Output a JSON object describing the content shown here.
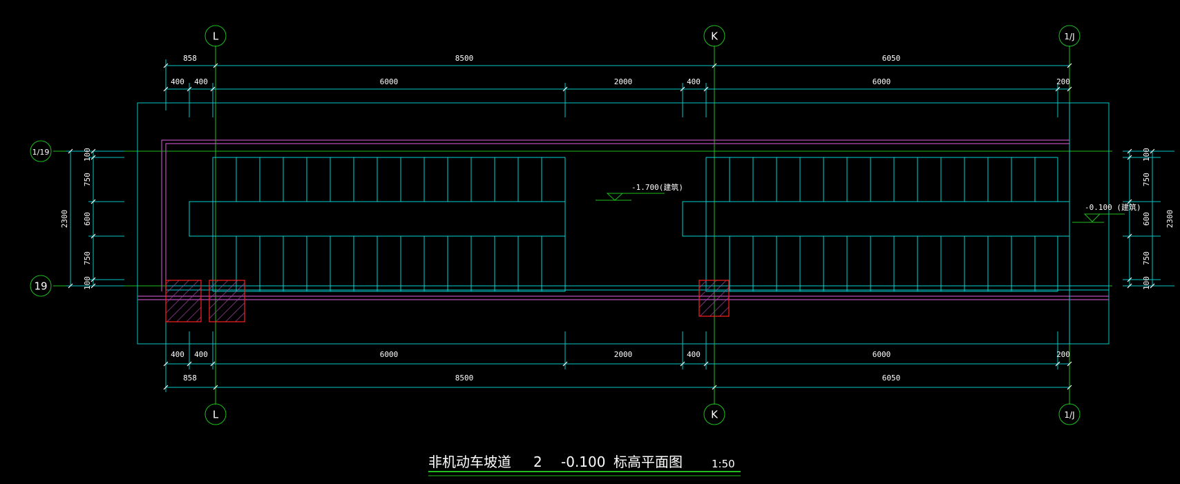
{
  "colors": {
    "background": "#000000",
    "dimension": "#00c8c8",
    "axis_line": "#1fc01f",
    "outline": "#00c8c8",
    "stair": "#00d5d5",
    "wall": "#b84cb8",
    "column": "#ff2020",
    "text": "#ffffff"
  },
  "axes": {
    "L": "L",
    "K": "K",
    "1J": "1/J",
    "19": "19",
    "1_19": "1/19"
  },
  "dims_top": {
    "row1": [
      "858",
      "8500",
      "6050"
    ],
    "row2": [
      "400",
      "400",
      "6000",
      "2000",
      "400",
      "6000",
      "200"
    ]
  },
  "dims_bottom": {
    "row1": [
      "400",
      "400",
      "6000",
      "2000",
      "400",
      "6000",
      "200"
    ],
    "row2": [
      "858",
      "8500",
      "6050"
    ]
  },
  "dims_left": {
    "segments": [
      "100",
      "750",
      "600",
      "750",
      "100"
    ],
    "total": "2300"
  },
  "dims_right": {
    "segments": [
      "100",
      "750",
      "600",
      "750",
      "100"
    ],
    "total": "2300"
  },
  "elevations": {
    "left": "-1.700(建筑)",
    "right": "-0.100 (建筑)"
  },
  "title": {
    "name": "非机动车坡道",
    "number": "2",
    "elevation": "-0.100",
    "suffix": "标高平面图",
    "scale": "1:50"
  }
}
